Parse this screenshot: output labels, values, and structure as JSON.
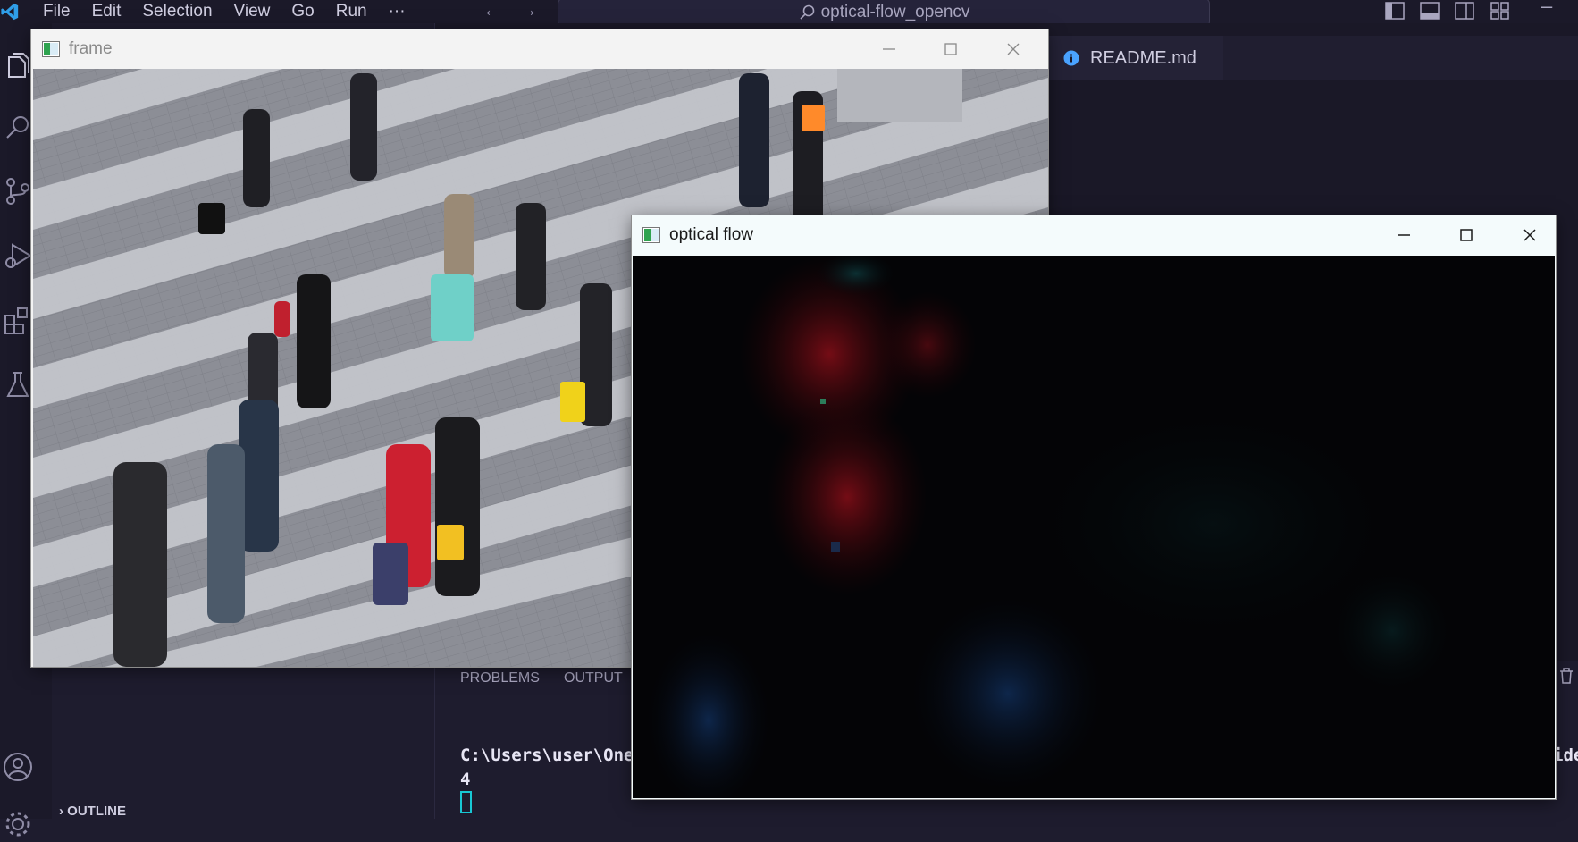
{
  "titlebar": {
    "menu": [
      "File",
      "Edit",
      "Selection",
      "View",
      "Go",
      "Run"
    ],
    "more": "···",
    "back_icon": "arrow-left-icon",
    "forward_icon": "arrow-right-icon",
    "search_text": "optical-flow_opencv",
    "minimize_glyph": "–"
  },
  "editor": {
    "tab_label": "README.md"
  },
  "panel": {
    "tabs": [
      "PROBLEMS",
      "OUTPUT"
    ],
    "terminal_lines": [
      "C:\\Users\\user\\OneD",
      "4"
    ],
    "terminal_overflow": "ide"
  },
  "sidebar": {
    "outline_label": "OUTLINE",
    "outline_chevron": "›"
  },
  "windows": {
    "frame": {
      "title": "frame"
    },
    "flow": {
      "title": "optical flow"
    }
  },
  "colors": {
    "accent": "#18c7d4",
    "titlebar_bg": "#1b1929",
    "editor_bg": "#1a1827"
  }
}
